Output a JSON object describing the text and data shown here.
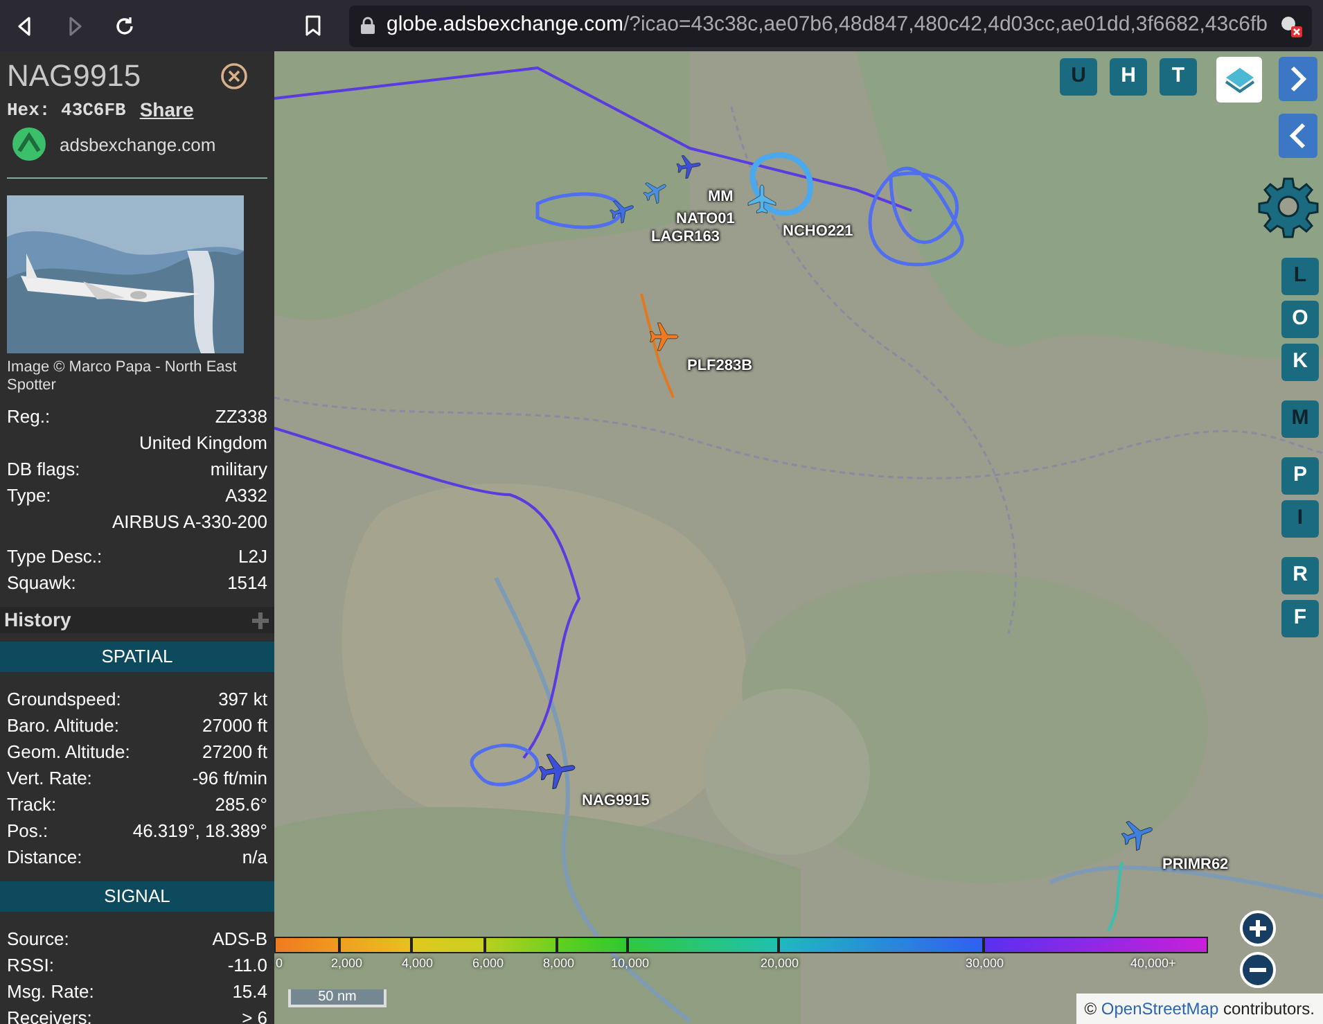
{
  "browser": {
    "back": {
      "disabled": false
    },
    "forward": {
      "disabled": true
    },
    "url_host": "globe.adsbexchange.com",
    "url_path": "/?icao=43c38c,ae07b6,48d847,480c42,4d03cc,ae01dd,3f6682,43c6fb"
  },
  "sidebar": {
    "callsign": "NAG9915",
    "hex_label": "Hex:",
    "hex": "43C6FB",
    "share": "Share",
    "source_site": "adsbexchange.com",
    "photo": {
      "kind": "picture",
      "credit": "Image © Marco Papa - North East Spotter"
    },
    "info": [
      {
        "label": "Reg.:",
        "value": "ZZ338"
      },
      {
        "value": "United Kingdom"
      },
      {
        "label": "DB flags:",
        "value": "military"
      },
      {
        "label": "Type:",
        "value": "A332"
      },
      {
        "value": "AIRBUS A-330-200"
      },
      {
        "label": "Type Desc.:",
        "value": "L2J"
      },
      {
        "label": "Squawk:",
        "value": "1514"
      }
    ],
    "history": {
      "title": "History",
      "expanded": false
    },
    "sections": [
      {
        "title": "SPATIAL",
        "rows": [
          {
            "label": "Groundspeed:",
            "value": "397 kt"
          },
          {
            "label": "Baro. Altitude:",
            "value": "27000 ft"
          },
          {
            "label": "Geom. Altitude:",
            "value": "27200 ft"
          },
          {
            "label": "Vert. Rate:",
            "value": "-96 ft/min"
          },
          {
            "label": "Track:",
            "value": "285.6°"
          },
          {
            "label": "Pos.:",
            "value": "46.319°, 18.389°"
          },
          {
            "label": "Distance:",
            "value": "n/a"
          }
        ]
      },
      {
        "title": "SIGNAL",
        "rows": [
          {
            "label": "Source:",
            "value": "ADS-B"
          },
          {
            "label": "RSSI:",
            "value": "-11.0"
          },
          {
            "label": "Msg. Rate:",
            "value": "15.4"
          },
          {
            "label": "Receivers:",
            "value": "> 6"
          }
        ]
      }
    ]
  },
  "map": {
    "aircraft": [
      {
        "callsign": "MM",
        "color": "#3b4fd8",
        "selected": false
      },
      {
        "callsign": "NATO01",
        "color": "#4a8fe0",
        "selected": false
      },
      {
        "callsign": "LAGR163",
        "color": "#3f6fe0",
        "selected": false
      },
      {
        "callsign": "NCHO221",
        "color": "#58b4e8",
        "selected": false
      },
      {
        "callsign": "PLF283B",
        "color": "#f07a20",
        "selected": false
      },
      {
        "callsign": "NAG9915",
        "color": "#3b4fd8",
        "selected": true
      },
      {
        "callsign": "PRIMR62",
        "color": "#3f7fe0",
        "selected": false
      }
    ],
    "top_buttons": [
      {
        "label": "U",
        "selected": true
      },
      {
        "label": "H",
        "selected": false
      },
      {
        "label": "T",
        "selected": false
      }
    ],
    "side_buttons": [
      {
        "label": "L",
        "selected": true
      },
      {
        "label": "O",
        "selected": false
      },
      {
        "label": "K",
        "selected": false
      },
      {
        "label": "M",
        "selected": true
      },
      {
        "label": "P",
        "selected": false
      },
      {
        "label": "I",
        "selected": true
      },
      {
        "label": "R",
        "selected": false
      },
      {
        "label": "F",
        "selected": false
      }
    ],
    "legend": [
      "0",
      "2,000",
      "4,000",
      "6,000",
      "8,000",
      "10,000",
      "20,000",
      "30,000",
      "40,000+"
    ],
    "scale": "50 nm",
    "attribution": {
      "prefix": "©",
      "link": "OpenStreetMap",
      "suffix": "contributors."
    }
  }
}
